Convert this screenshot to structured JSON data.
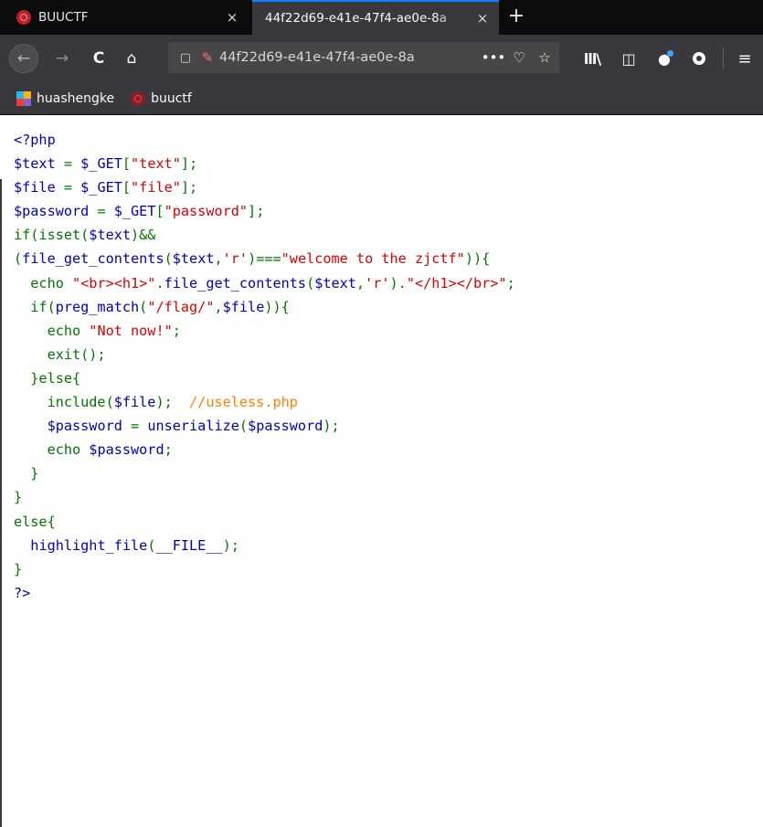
{
  "browser": {
    "tabs": [
      {
        "title": "BUUCTF",
        "active": false
      },
      {
        "title": "44f22d69-e41e-47f4-ae0e-8a",
        "active": true
      }
    ],
    "new_tab_label": "+",
    "url": "44f22d69-e41e-47f4-ae0e-8a",
    "url_more": "•••",
    "bookmarks": [
      {
        "label": "huashengke"
      },
      {
        "label": "buuctf"
      }
    ]
  },
  "icons": {
    "close": "×",
    "back": "←",
    "forward": "→",
    "reload": "C",
    "home": "⌂",
    "shield": "▢",
    "lock": "✎",
    "pocket": "♡",
    "star": "☆",
    "library": "lll\\",
    "sidebar": "◫",
    "account": "●",
    "menu": "≡"
  },
  "colors": {
    "php_keyword": "#007700",
    "php_string": "#dd0000",
    "php_comment": "#ff8000",
    "php_default": "#0000bb",
    "tab_accent": "#0a84ff"
  },
  "code_lines": [
    [
      {
        "t": "<?php",
        "c": "d"
      }
    ],
    [
      {
        "t": "$text",
        "c": "d"
      },
      {
        "t": " = ",
        "c": "k"
      },
      {
        "t": "$_GET",
        "c": "d"
      },
      {
        "t": "[",
        "c": "k"
      },
      {
        "t": "\"text\"",
        "c": "s"
      },
      {
        "t": "];",
        "c": "k"
      }
    ],
    [
      {
        "t": "$file",
        "c": "d"
      },
      {
        "t": " = ",
        "c": "k"
      },
      {
        "t": "$_GET",
        "c": "d"
      },
      {
        "t": "[",
        "c": "k"
      },
      {
        "t": "\"file\"",
        "c": "s"
      },
      {
        "t": "];",
        "c": "k"
      }
    ],
    [
      {
        "t": "$password",
        "c": "d"
      },
      {
        "t": " = ",
        "c": "k"
      },
      {
        "t": "$_GET",
        "c": "d"
      },
      {
        "t": "[",
        "c": "k"
      },
      {
        "t": "\"password\"",
        "c": "s"
      },
      {
        "t": "];",
        "c": "k"
      }
    ],
    [
      {
        "t": "if(isset(",
        "c": "k"
      },
      {
        "t": "$text",
        "c": "d"
      },
      {
        "t": ")&&",
        "c": "k"
      }
    ],
    [
      {
        "t": "(",
        "c": "k"
      },
      {
        "t": "file_get_contents",
        "c": "d"
      },
      {
        "t": "(",
        "c": "k"
      },
      {
        "t": "$text",
        "c": "d"
      },
      {
        "t": ",",
        "c": "k"
      },
      {
        "t": "'r'",
        "c": "s"
      },
      {
        "t": ")===",
        "c": "k"
      },
      {
        "t": "\"welcome to the zjctf\"",
        "c": "s"
      },
      {
        "t": ")){",
        "c": "k"
      }
    ],
    [
      {
        "t": "  echo ",
        "c": "k"
      },
      {
        "t": "\"<br><h1>\"",
        "c": "s"
      },
      {
        "t": ".",
        "c": "k"
      },
      {
        "t": "file_get_contents",
        "c": "d"
      },
      {
        "t": "(",
        "c": "k"
      },
      {
        "t": "$text",
        "c": "d"
      },
      {
        "t": ",",
        "c": "k"
      },
      {
        "t": "'r'",
        "c": "s"
      },
      {
        "t": ").",
        "c": "k"
      },
      {
        "t": "\"</h1></br>\"",
        "c": "s"
      },
      {
        "t": ";",
        "c": "k"
      }
    ],
    [
      {
        "t": "  if(",
        "c": "k"
      },
      {
        "t": "preg_match",
        "c": "d"
      },
      {
        "t": "(",
        "c": "k"
      },
      {
        "t": "\"/flag/\"",
        "c": "s"
      },
      {
        "t": ",",
        "c": "k"
      },
      {
        "t": "$file",
        "c": "d"
      },
      {
        "t": ")){",
        "c": "k"
      }
    ],
    [
      {
        "t": "    echo ",
        "c": "k"
      },
      {
        "t": "\"Not now!\"",
        "c": "s"
      },
      {
        "t": ";",
        "c": "k"
      }
    ],
    [
      {
        "t": "    exit();",
        "c": "k"
      }
    ],
    [
      {
        "t": "  }else{",
        "c": "k"
      }
    ],
    [
      {
        "t": "    include(",
        "c": "k"
      },
      {
        "t": "$file",
        "c": "d"
      },
      {
        "t": ");  ",
        "c": "k"
      },
      {
        "t": "//useless.php",
        "c": "c"
      }
    ],
    [
      {
        "t": "    ",
        "c": "k"
      },
      {
        "t": "$password",
        "c": "d"
      },
      {
        "t": " = ",
        "c": "k"
      },
      {
        "t": "unserialize",
        "c": "d"
      },
      {
        "t": "(",
        "c": "k"
      },
      {
        "t": "$password",
        "c": "d"
      },
      {
        "t": ");",
        "c": "k"
      }
    ],
    [
      {
        "t": "    echo ",
        "c": "k"
      },
      {
        "t": "$password",
        "c": "d"
      },
      {
        "t": ";",
        "c": "k"
      }
    ],
    [
      {
        "t": "  }",
        "c": "k"
      }
    ],
    [
      {
        "t": "}",
        "c": "k"
      }
    ],
    [
      {
        "t": "else{",
        "c": "k"
      }
    ],
    [
      {
        "t": "  ",
        "c": "k"
      },
      {
        "t": "highlight_file",
        "c": "d"
      },
      {
        "t": "(",
        "c": "k"
      },
      {
        "t": "__FILE__",
        "c": "d"
      },
      {
        "t": ");",
        "c": "k"
      }
    ],
    [
      {
        "t": "}",
        "c": "k"
      }
    ],
    [
      {
        "t": "?>",
        "c": "d"
      }
    ]
  ]
}
